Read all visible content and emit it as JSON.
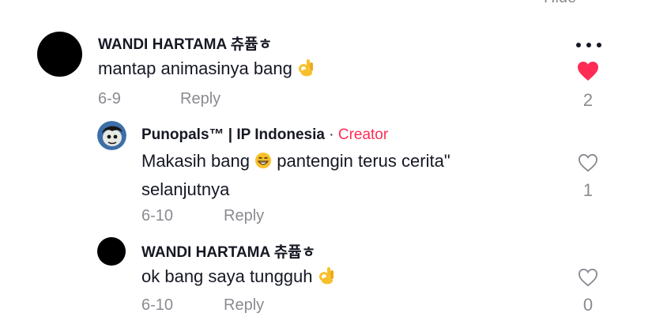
{
  "hide_label": "Hide",
  "colors": {
    "text": "#161823",
    "muted": "#8a8b91",
    "accent": "#fe2c55",
    "avatar": "#000000"
  },
  "comments": [
    {
      "username": "WANDI HARTAMA 츄퓹ㅎ",
      "text": "mantap animasinya bang",
      "emoji": "ok-hand-icon",
      "date": "6-9",
      "reply_label": "Reply",
      "liked": true,
      "likes": "2"
    },
    {
      "username": "Punopals™ | IP Indonesia",
      "separator": "·",
      "badge": "Creator",
      "text_line1_before": "Makasih bang",
      "emoji": "grinning-face-icon",
      "text_line1_after": "pantengin terus cerita\"",
      "text_line2": "selanjutnya",
      "date": "6-10",
      "reply_label": "Reply",
      "liked": false,
      "likes": "1"
    },
    {
      "username": "WANDI HARTAMA 츄퓹ㅎ",
      "text": "ok bang saya tungguh",
      "emoji": "ok-hand-icon",
      "date": "6-10",
      "reply_label": "Reply",
      "liked": false,
      "likes": "0"
    }
  ]
}
